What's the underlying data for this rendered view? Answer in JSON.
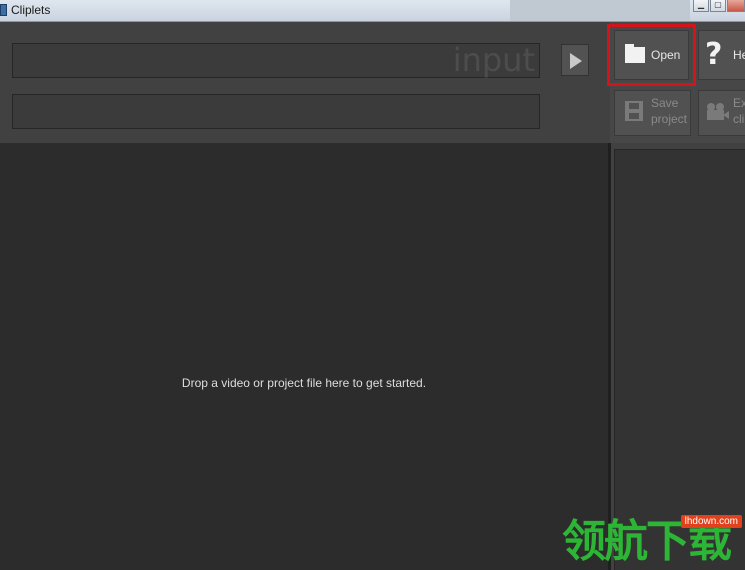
{
  "window": {
    "title": "Cliplets",
    "controls": {
      "minimize": "▁",
      "maximize": "▢"
    }
  },
  "toolbar": {
    "input_watermark": "input",
    "open_label": "Open",
    "help_label": "He",
    "save_label_line1": "Save",
    "save_label_line2": "project",
    "export_label_line1": "Ex",
    "export_label_line2": "cli"
  },
  "main": {
    "drop_hint": "Drop a video or project file here to get started."
  },
  "watermark": {
    "text": "领航下载",
    "url": "lhdown.com"
  },
  "colors": {
    "highlight": "#d4141b",
    "watermark_green": "#2db535",
    "watermark_badge": "#e2411b"
  },
  "icons": [
    "folder-icon",
    "help-icon",
    "save-icon",
    "camera-icon",
    "play-icon"
  ]
}
